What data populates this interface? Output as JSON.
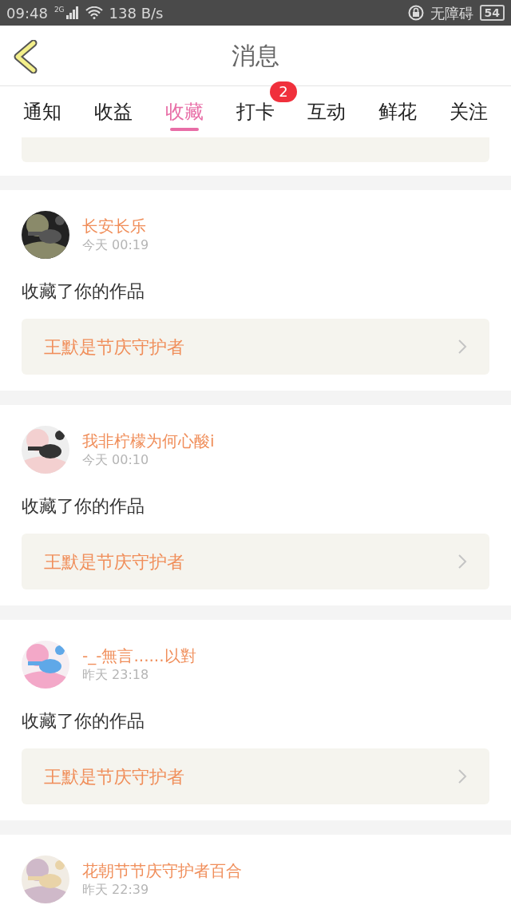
{
  "status_bar": {
    "time": "09:48",
    "network": "2G",
    "speed": "138 B/s",
    "accessibility": "无障碍",
    "battery": "54"
  },
  "header": {
    "title": "消息"
  },
  "tabs": [
    {
      "label": "通知",
      "selected": false
    },
    {
      "label": "收益",
      "selected": false
    },
    {
      "label": "收藏",
      "selected": true
    },
    {
      "label": "打卡",
      "selected": false,
      "badge": "2"
    },
    {
      "label": "互动",
      "selected": false
    },
    {
      "label": "鲜花",
      "selected": false
    },
    {
      "label": "关注",
      "selected": false
    }
  ],
  "messages": [
    {
      "user": "长安长乐",
      "time": "今天 00:19",
      "action": "收藏了你的作品",
      "work": "王默是节庆守护者"
    },
    {
      "user": "我非柠檬为何心酸i",
      "time": "今天 00:10",
      "action": "收藏了你的作品",
      "work": "王默是节庆守护者"
    },
    {
      "user": "-_-無言......以對",
      "time": "昨天 23:18",
      "action": "收藏了你的作品",
      "work": "王默是节庆守护者"
    },
    {
      "user": "花朝节节庆守护者百合",
      "time": "昨天 22:39"
    }
  ]
}
